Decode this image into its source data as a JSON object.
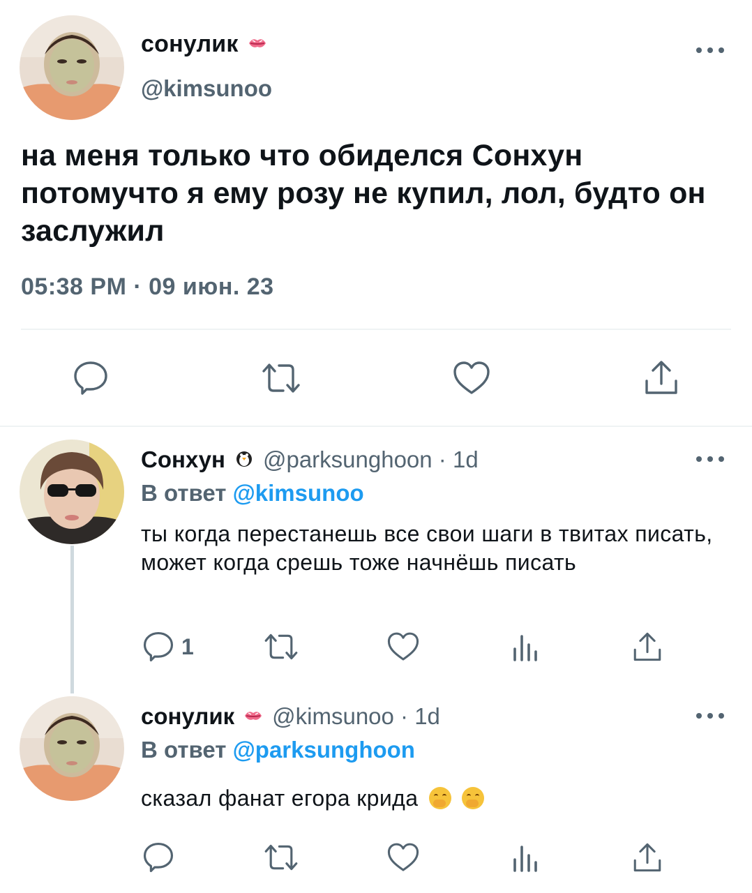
{
  "main_tweet": {
    "author_name": "сонулик",
    "author_badge": "kiss-mark-icon",
    "author_handle": "@kimsunoo",
    "text": "на меня только что обиделся Сонхун потомучто я ему розу не купил, лол, будто он заслужил",
    "timestamp": "05:38 PM · 09 июн. 23",
    "actions": [
      "reply-icon",
      "retweet-icon",
      "like-icon",
      "share-icon"
    ]
  },
  "replies": [
    {
      "author_name": "Сонхун",
      "author_badge": "penguin-icon",
      "meta": "@parksunghoon · 1d",
      "replying_prefix": "В ответ",
      "replying_to": "@kimsunoo",
      "text": "ты когда перестанешь все свои шаги в твитах писать, может когда срешь тоже начнёшь писать",
      "reply_count": "1"
    },
    {
      "author_name": "сонулик",
      "author_badge": "kiss-mark-icon",
      "meta": "@kimsunoo · 1d",
      "replying_prefix": "В ответ",
      "replying_to": "@parksunghoon",
      "text": "сказал фанат егора крида",
      "emojis": [
        "hand-over-mouth-emoji",
        "hand-over-mouth-emoji"
      ]
    }
  ],
  "colors": {
    "text": "#0f1419",
    "secondary": "#536471",
    "link": "#1d9bf0",
    "divider": "#eff3f4",
    "thread_line": "#cfd9de"
  }
}
